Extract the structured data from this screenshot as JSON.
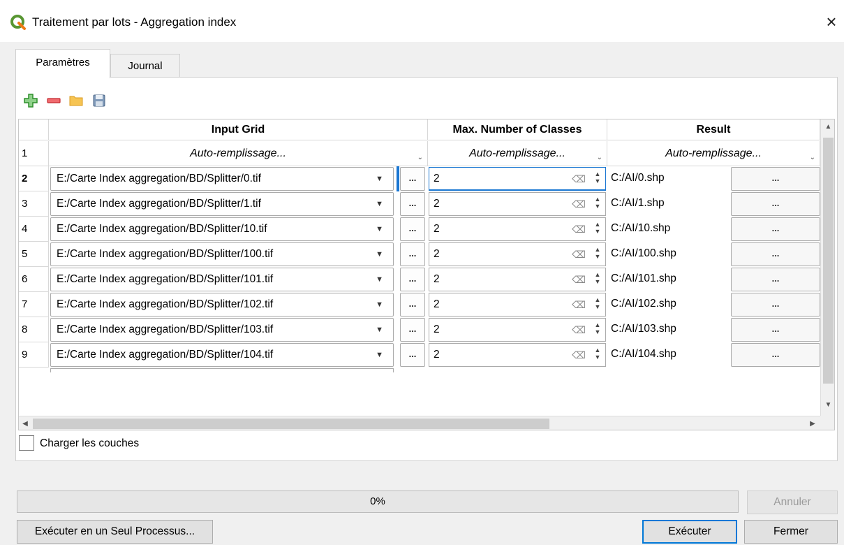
{
  "window": {
    "title": "Traitement par lots - Aggregation index",
    "close_glyph": "×"
  },
  "tabs": [
    {
      "label": "Paramètres",
      "active": true
    },
    {
      "label": "Journal",
      "active": false
    }
  ],
  "toolbar": {
    "icons": [
      "add-row-icon",
      "remove-row-icon",
      "open-folder-icon",
      "save-icon"
    ],
    "colors": {
      "add": "#3aa238",
      "remove": "#e0373d",
      "folder": "#f2b53a",
      "save": "#5f7fa3"
    }
  },
  "table": {
    "headers": [
      "Input Grid",
      "Max. Number of Classes",
      "Result"
    ],
    "autofill_row_number": "1",
    "autofill_label": "Auto-remplissage...",
    "browse_label": "...",
    "rows": [
      {
        "num": "2",
        "input": "E:/Carte Index aggregation/BD/Splitter/0.tif",
        "classes": "2",
        "result": "C:/AI/0.shp"
      },
      {
        "num": "3",
        "input": "E:/Carte Index aggregation/BD/Splitter/1.tif",
        "classes": "2",
        "result": "C:/AI/1.shp"
      },
      {
        "num": "4",
        "input": "E:/Carte Index aggregation/BD/Splitter/10.tif",
        "classes": "2",
        "result": "C:/AI/10.shp"
      },
      {
        "num": "5",
        "input": "E:/Carte Index aggregation/BD/Splitter/100.tif",
        "classes": "2",
        "result": "C:/AI/100.shp"
      },
      {
        "num": "6",
        "input": "E:/Carte Index aggregation/BD/Splitter/101.tif",
        "classes": "2",
        "result": "C:/AI/101.shp"
      },
      {
        "num": "7",
        "input": "E:/Carte Index aggregation/BD/Splitter/102.tif",
        "classes": "2",
        "result": "C:/AI/102.shp"
      },
      {
        "num": "8",
        "input": "E:/Carte Index aggregation/BD/Splitter/103.tif",
        "classes": "2",
        "result": "C:/AI/103.shp"
      },
      {
        "num": "9",
        "input": "E:/Carte Index aggregation/BD/Splitter/104.tif",
        "classes": "2",
        "result": "C:/AI/104.shp"
      }
    ]
  },
  "load_layers": {
    "label": "Charger les couches",
    "checked": false
  },
  "progress": {
    "text": "0%",
    "value": 0
  },
  "buttons": {
    "cancel": "Annuler",
    "single_process": "Exécuter en un Seul Processus...",
    "run": "Exécuter",
    "close": "Fermer"
  },
  "accent_color": "#1976d2"
}
